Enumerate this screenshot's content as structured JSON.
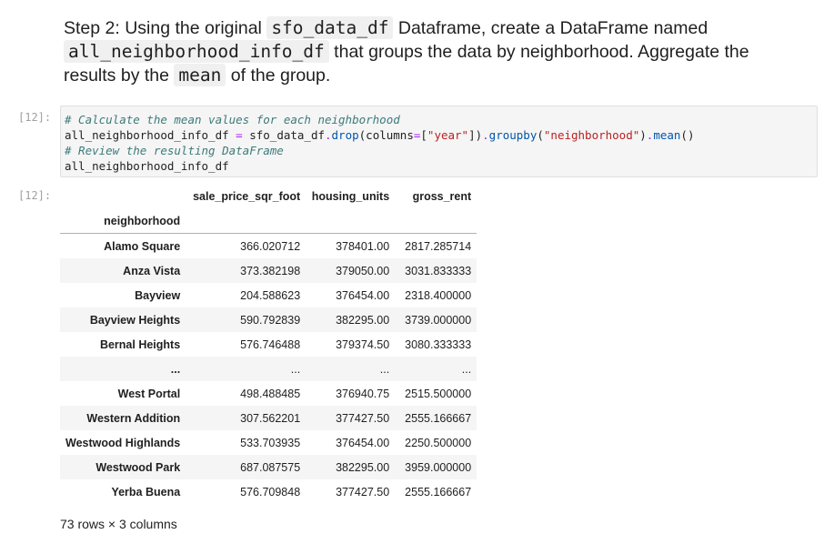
{
  "markdown": {
    "prefix": "Step 2: Using the original ",
    "code1": "sfo_data_df",
    "mid1": " Dataframe, create a DataFrame named ",
    "code2": "all_neighborhood_info_df",
    "mid2": " that groups the data by neighborhood. Aggregate the results by the ",
    "code3": "mean",
    "suffix": " of the group."
  },
  "code_cell": {
    "prompt": "[12]:",
    "comment1": "# Calculate the mean values for each neighborhood",
    "line2_a": "all_neighborhood_info_df ",
    "line2_eq": "=",
    "line2_b": " sfo_data_df",
    "line2_dot1": ".",
    "line2_drop": "drop",
    "line2_c": "(columns",
    "line2_eq2": "=",
    "line2_d": "[",
    "line2_str1": "\"year\"",
    "line2_e": "])",
    "line2_dot2": ".",
    "line2_groupby": "groupby",
    "line2_f": "(",
    "line2_str2": "\"neighborhood\"",
    "line2_g": ")",
    "line2_dot3": ".",
    "line2_mean": "mean",
    "line2_h": "()",
    "comment2": "# Review the resulting DataFrame",
    "line4": "all_neighborhood_info_df"
  },
  "output": {
    "prompt": "[12]:",
    "columns": [
      "sale_price_sqr_foot",
      "housing_units",
      "gross_rent"
    ],
    "index_name": "neighborhood",
    "rows": [
      {
        "name": "Alamo Square",
        "a": "366.020712",
        "b": "378401.00",
        "c": "2817.285714"
      },
      {
        "name": "Anza Vista",
        "a": "373.382198",
        "b": "379050.00",
        "c": "3031.833333"
      },
      {
        "name": "Bayview",
        "a": "204.588623",
        "b": "376454.00",
        "c": "2318.400000"
      },
      {
        "name": "Bayview Heights",
        "a": "590.792839",
        "b": "382295.00",
        "c": "3739.000000"
      },
      {
        "name": "Bernal Heights",
        "a": "576.746488",
        "b": "379374.50",
        "c": "3080.333333"
      },
      {
        "name": "...",
        "a": "...",
        "b": "...",
        "c": "..."
      },
      {
        "name": "West Portal",
        "a": "498.488485",
        "b": "376940.75",
        "c": "2515.500000"
      },
      {
        "name": "Western Addition",
        "a": "307.562201",
        "b": "377427.50",
        "c": "2555.166667"
      },
      {
        "name": "Westwood Highlands",
        "a": "533.703935",
        "b": "376454.00",
        "c": "2250.500000"
      },
      {
        "name": "Westwood Park",
        "a": "687.087575",
        "b": "382295.00",
        "c": "3959.000000"
      },
      {
        "name": "Yerba Buena",
        "a": "576.709848",
        "b": "377427.50",
        "c": "2555.166667"
      }
    ],
    "shape": "73 rows × 3 columns"
  }
}
